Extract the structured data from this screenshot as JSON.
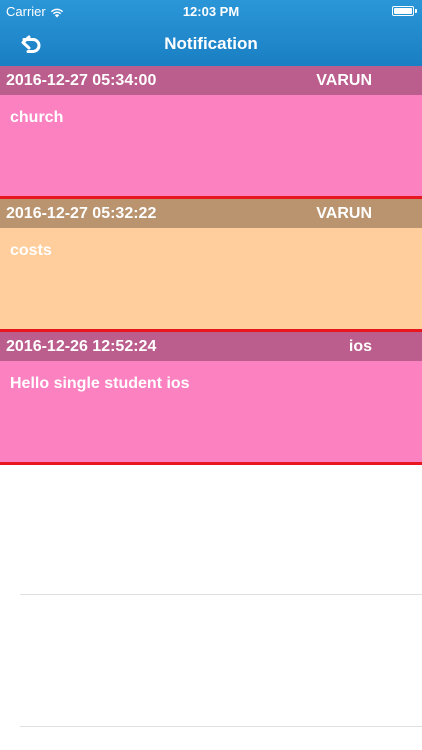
{
  "status_bar": {
    "carrier": "Carrier",
    "time": "12:03 PM"
  },
  "nav": {
    "title": "Notification",
    "back_icon": "undo-arrow-icon"
  },
  "notifications": [
    {
      "date": "2016-12-27 05:34:00",
      "sender": "VARUN",
      "message": "church",
      "header_color": "#bb5e8d",
      "body_color": "#fc81c1"
    },
    {
      "date": "2016-12-27 05:32:22",
      "sender": "VARUN",
      "message": "costs",
      "header_color": "#b9946f",
      "body_color": "#ffce9c"
    },
    {
      "date": "2016-12-26 12:52:24",
      "sender": "ios",
      "message": "Hello single student ios",
      "header_color": "#bb5e8d",
      "body_color": "#fc81c1"
    }
  ],
  "colors": {
    "nav_bar": "#1f88cc",
    "card_border": "#e8161f"
  }
}
